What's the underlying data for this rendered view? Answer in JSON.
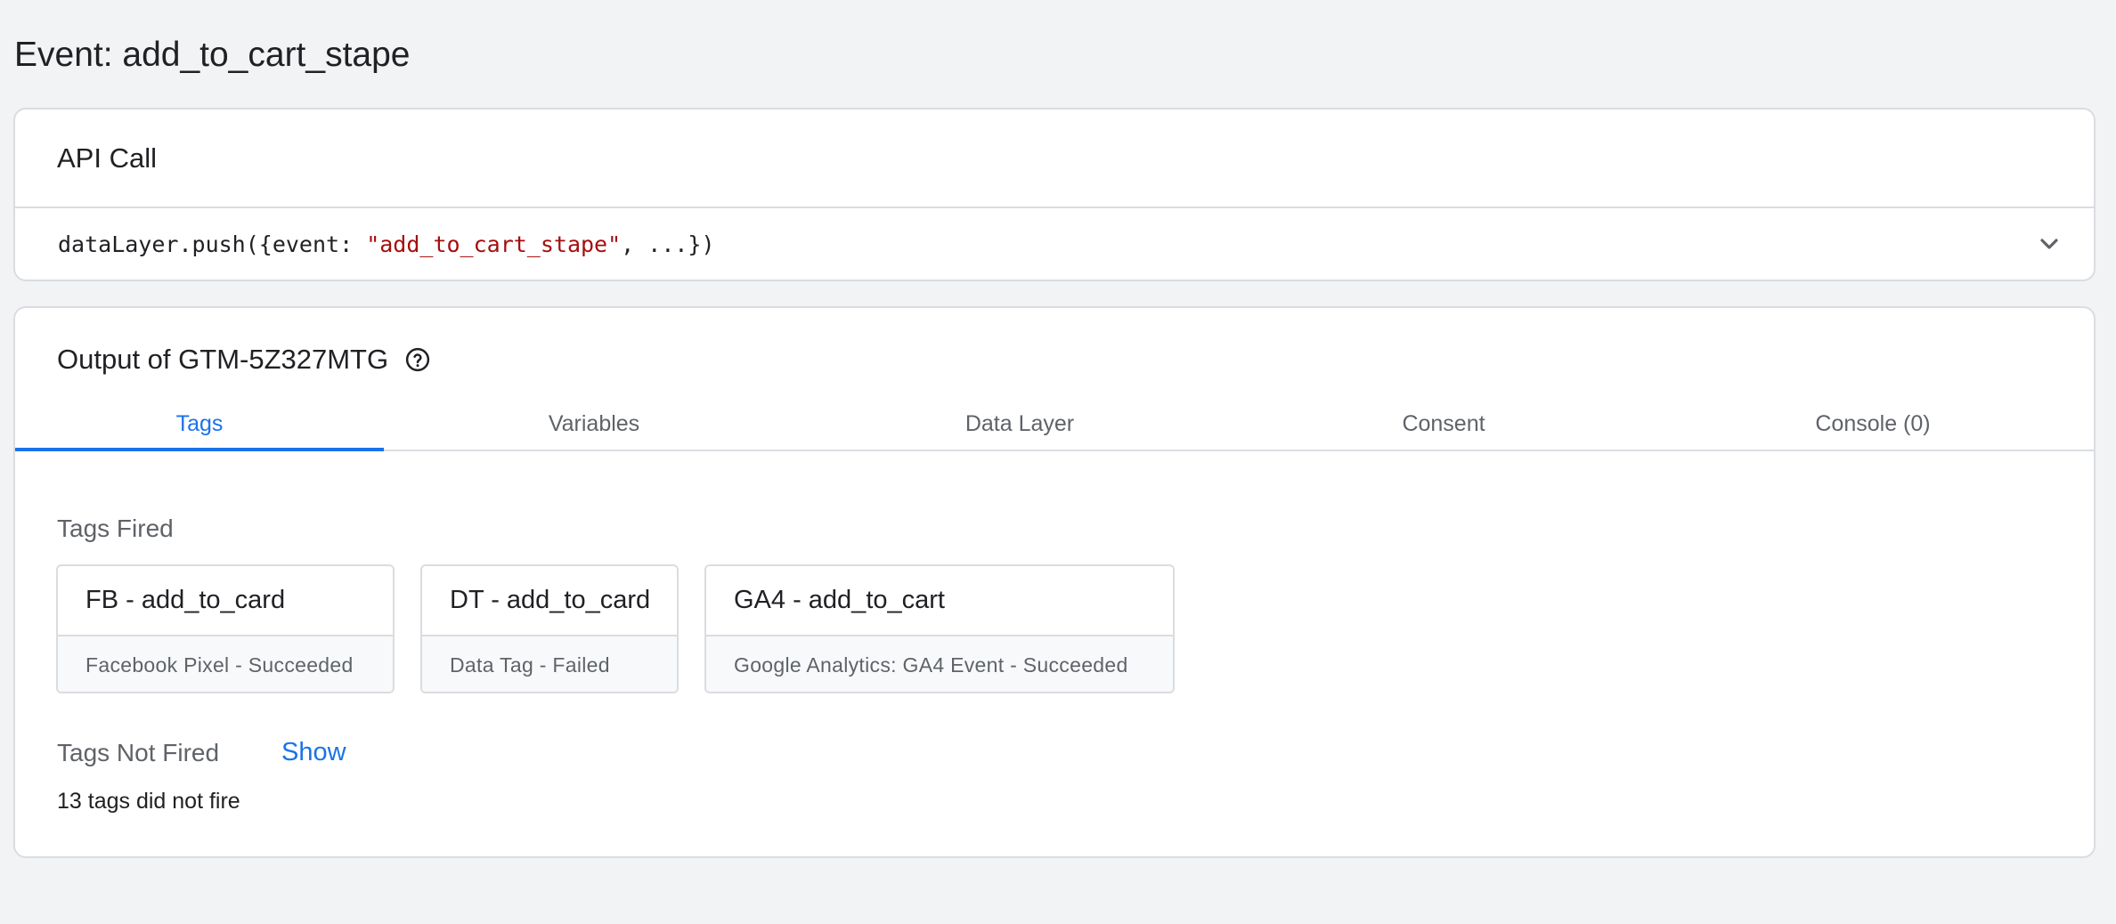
{
  "page": {
    "title": "Event: add_to_cart_stape"
  },
  "api_call": {
    "header": "API Call",
    "code_prefix": "dataLayer.push({event: ",
    "code_string": "\"add_to_cart_stape\"",
    "code_suffix": ", ...})",
    "expand_icon": "chevron-down-icon"
  },
  "output": {
    "title": "Output of GTM-5Z327MTG",
    "help_icon": "help-circle-icon",
    "tabs": [
      {
        "label": "Tags",
        "active": true
      },
      {
        "label": "Variables",
        "active": false
      },
      {
        "label": "Data Layer",
        "active": false
      },
      {
        "label": "Consent",
        "active": false
      },
      {
        "label": "Console (0)",
        "active": false
      }
    ],
    "tags_fired_label": "Tags Fired",
    "tags_fired": [
      {
        "name": "FB - add_to_card",
        "status": "Facebook Pixel - Succeeded"
      },
      {
        "name": "DT - add_to_card",
        "status": "Data Tag - Failed"
      },
      {
        "name": "GA4 - add_to_cart",
        "status": "Google Analytics: GA4 Event - Succeeded"
      }
    ],
    "tags_not_fired_label": "Tags Not Fired",
    "show_link": "Show",
    "not_fired_count_text": "13 tags did not fire"
  },
  "colors": {
    "accent": "#1a73e8",
    "string": "#a50e0e",
    "background": "#f1f3f4"
  }
}
